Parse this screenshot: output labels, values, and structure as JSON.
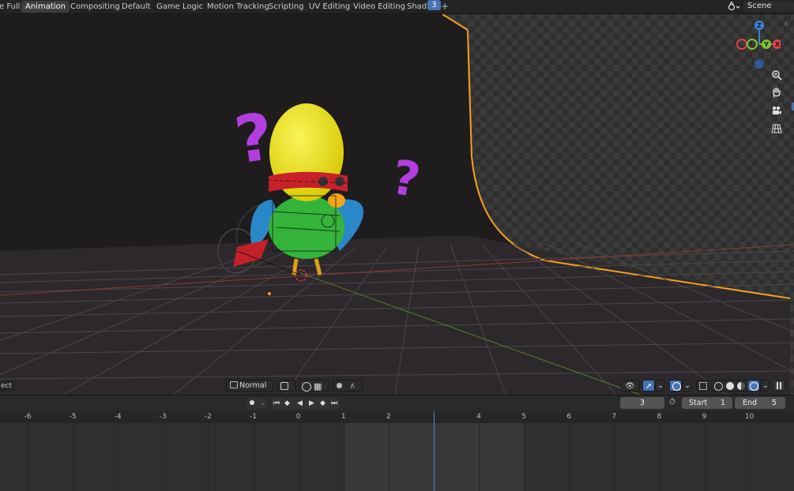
{
  "workspace_tabs": [
    {
      "label": "e Full",
      "active": false
    },
    {
      "label": "Animation",
      "active": true
    },
    {
      "label": "Compositing",
      "active": false
    },
    {
      "label": "Default",
      "active": false
    },
    {
      "label": "Game Logic",
      "active": false
    },
    {
      "label": "Motion Tracking",
      "active": false
    },
    {
      "label": "Scripting",
      "active": false
    },
    {
      "label": "UV Editing",
      "active": false
    },
    {
      "label": "Video Editing",
      "active": false
    },
    {
      "label": "Shading",
      "active": false
    }
  ],
  "add_tab_symbol": "+",
  "scene": {
    "name": "Scene",
    "icon": "scene-icon"
  },
  "gizmo": {
    "z": "Z",
    "y": "Y",
    "x": "X",
    "colors": {
      "x": "#e5404e",
      "y": "#7fc52e",
      "z": "#3c83d4"
    }
  },
  "viewport": {
    "mode_hint": "ect",
    "question_mark": "?",
    "nav_icons": [
      "zoom-icon",
      "pan-hand-icon",
      "camera-icon",
      "grid-icon"
    ]
  },
  "viewport_header": {
    "orientation": "Normal",
    "chevron": "⌄",
    "pivot_icon": "pivot-icon",
    "snap_icon": "snap-icon",
    "proportional_icon": "proportional-edit-icon",
    "falloff_icon": "falloff-curve-icon",
    "shading_mode": "rendered"
  },
  "timeline": {
    "current_frame": "3",
    "start_label": "Start",
    "start_value": "1",
    "end_label": "End",
    "end_value": "5",
    "ticks": [
      "-6",
      "-5",
      "-4",
      "-3",
      "-2",
      "-1",
      "0",
      "1",
      "2",
      "3",
      "4",
      "5",
      "6",
      "7",
      "8",
      "9",
      "10"
    ],
    "controls": [
      "record-icon",
      "jump-start-icon",
      "prev-keyframe-icon",
      "play-reverse-icon",
      "play-icon",
      "next-keyframe-icon",
      "jump-end-icon"
    ]
  },
  "colors": {
    "accent": "#4772b3",
    "selection_orange": "#f5a020",
    "background": "#1d1d1d"
  }
}
